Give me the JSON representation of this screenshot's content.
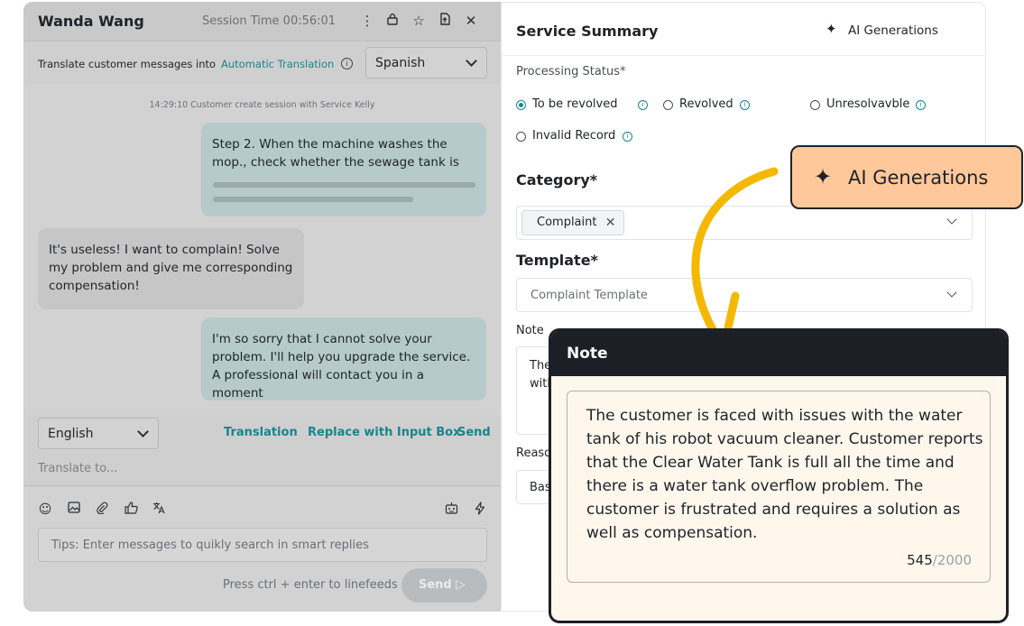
{
  "chat": {
    "agent_name": "Wanda Wang",
    "session_time": "Session Time 00:56:01",
    "header_icons": [
      "more-icon",
      "lock-icon",
      "star-icon",
      "export-icon",
      "close-icon"
    ],
    "translate_label": "Translate customer messages into",
    "auto_translation": "Automatic Translation",
    "target_language": "Spanish",
    "system_message": "14:29:10   Customer create session with Service Kelly",
    "messages": [
      {
        "from": "agent",
        "text": "Step 2. When the machine washes the mop., check whether the sewage tank is"
      },
      {
        "from": "customer",
        "text": "It's useless! I want to complain! Solve my problem and give me corresponding compensation!"
      },
      {
        "from": "agent",
        "text": "I'm so sorry that I cannot solve your problem. I'll help you upgrade the service. A professional will contact you in a moment"
      }
    ],
    "input_language": "English",
    "actions": {
      "translation": "Translation",
      "replace": "Replace with Input Box",
      "send": "Send"
    },
    "translate_to_placeholder": "Translate to...",
    "tool_icons": [
      "emoji-icon",
      "image-icon",
      "attachment-icon",
      "thumbs-up-icon",
      "translate-icon",
      "robot-icon",
      "flash-icon"
    ],
    "tips_placeholder": "Tips: Enter messages to quikly search in smart replies",
    "hint": "Press ctrl + enter to linefeeds",
    "send_label": "Send"
  },
  "summary": {
    "title": "Service Summary",
    "ai_generations": "AI Generations",
    "processing_status_label": "Processing Status*",
    "statuses": [
      {
        "label": "To be revolved",
        "selected": true
      },
      {
        "label": "Revolved",
        "selected": false
      },
      {
        "label": "Unresolvavble",
        "selected": false
      },
      {
        "label": "Invalid Record",
        "selected": false
      }
    ],
    "category_label": "Category*",
    "category_tag": "Complaint",
    "template_label": "Template*",
    "template_value": "Complaint Template",
    "note_label": "Note",
    "note_preview": "The with",
    "reason_label": "Reaso",
    "reason_preview": "Bas"
  },
  "callout": {
    "label": "AI Generations"
  },
  "note_card": {
    "title": "Note",
    "text": "The customer is faced with issues with the water tank of his robot vacuum cleaner. Customer reports that the Clear Water Tank is full all the time and there is a water tank overflow problem. The customer is frustrated and requires a solution as well as compensation.",
    "count": "545",
    "max": "/2000"
  },
  "colors": {
    "accent": "#16868d",
    "callout_bg": "#ffc89a",
    "arrow": "#f5b800",
    "card_head": "#1c1f26",
    "card_bg": "#fff7ec"
  }
}
